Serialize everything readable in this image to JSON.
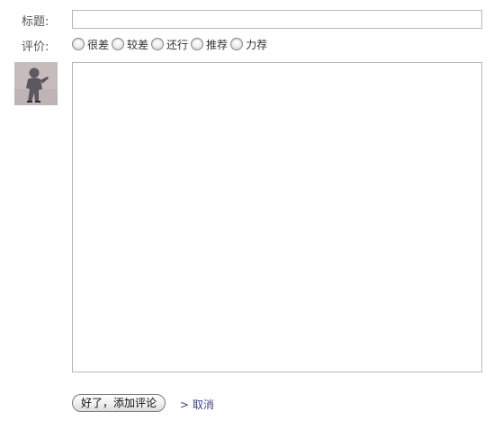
{
  "form": {
    "title_label": "标题:",
    "title_value": "",
    "rating_label": "评价:",
    "rating_options": [
      {
        "label": "很差",
        "checked": false
      },
      {
        "label": "较差",
        "checked": false
      },
      {
        "label": "还行",
        "checked": false
      },
      {
        "label": "推荐",
        "checked": false
      },
      {
        "label": "力荐",
        "checked": false
      }
    ],
    "comment_value": "",
    "submit_label": "好了，添加评论",
    "cancel_label": "> 取消"
  },
  "colors": {
    "cancel_link": "#3b3f8f",
    "border": "#b8b8b8",
    "label_text": "#555555"
  },
  "icons": {
    "avatar": "user-avatar-photo"
  }
}
